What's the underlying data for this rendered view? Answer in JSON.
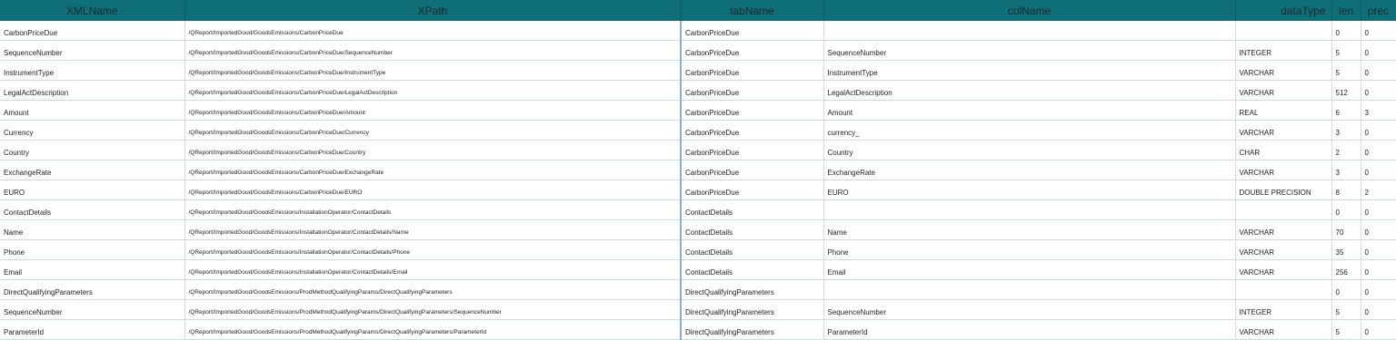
{
  "headers": {
    "xmlname": "XMLName",
    "xpath": "XPath",
    "tabname": "tabName",
    "colname": "colName",
    "datatype": "dataType",
    "len": "len",
    "prec": "prec"
  },
  "rows": [
    {
      "xmlname": "CarbonPriceDue",
      "xpath": "/QReport/ImportedGood/GoodsEmissions/CarbonPriceDue",
      "tabname": "CarbonPriceDue",
      "colname": "",
      "datatype": "",
      "len": "0",
      "prec": "0"
    },
    {
      "xmlname": "SequenceNumber",
      "xpath": "/QReport/ImportedGood/GoodsEmissions/CarbonPriceDue/SequenceNumber",
      "tabname": "CarbonPriceDue",
      "colname": "SequenceNumber",
      "datatype": "INTEGER",
      "len": "5",
      "prec": "0"
    },
    {
      "xmlname": "InstrumentType",
      "xpath": "/QReport/ImportedGood/GoodsEmissions/CarbonPriceDue/InstrumentType",
      "tabname": "CarbonPriceDue",
      "colname": "InstrumentType",
      "datatype": "VARCHAR",
      "len": "5",
      "prec": "0"
    },
    {
      "xmlname": "LegalActDescription",
      "xpath": "/QReport/ImportedGood/GoodsEmissions/CarbonPriceDue/LegalActDescription",
      "tabname": "CarbonPriceDue",
      "colname": "LegalActDescription",
      "datatype": "VARCHAR",
      "len": "512",
      "prec": "0"
    },
    {
      "xmlname": "Amount",
      "xpath": "/QReport/ImportedGood/GoodsEmissions/CarbonPriceDue/Amount",
      "tabname": "CarbonPriceDue",
      "colname": "Amount",
      "datatype": "REAL",
      "len": "6",
      "prec": "3"
    },
    {
      "xmlname": "Currency",
      "xpath": "/QReport/ImportedGood/GoodsEmissions/CarbonPriceDue/Currency",
      "tabname": "CarbonPriceDue",
      "colname": "currency_",
      "datatype": "VARCHAR",
      "len": "3",
      "prec": "0"
    },
    {
      "xmlname": "Country",
      "xpath": "/QReport/ImportedGood/GoodsEmissions/CarbonPriceDue/Country",
      "tabname": "CarbonPriceDue",
      "colname": "Country",
      "datatype": "CHAR",
      "len": "2",
      "prec": "0"
    },
    {
      "xmlname": "ExchangeRate",
      "xpath": "/QReport/ImportedGood/GoodsEmissions/CarbonPriceDue/ExchangeRate",
      "tabname": "CarbonPriceDue",
      "colname": "ExchangeRate",
      "datatype": "VARCHAR",
      "len": "3",
      "prec": "0"
    },
    {
      "xmlname": "EURO",
      "xpath": "/QReport/ImportedGood/GoodsEmissions/CarbonPriceDue/EURO",
      "tabname": "CarbonPriceDue",
      "colname": "EURO",
      "datatype": "DOUBLE PRECISION",
      "len": "8",
      "prec": "2"
    },
    {
      "xmlname": "ContactDetails",
      "xpath": "/QReport/ImportedGood/GoodsEmissions/InstallationOperator/ContactDetails",
      "tabname": "ContactDetails",
      "colname": "",
      "datatype": "",
      "len": "0",
      "prec": "0"
    },
    {
      "xmlname": "Name",
      "xpath": "/QReport/ImportedGood/GoodsEmissions/InstallationOperator/ContactDetails/Name",
      "tabname": "ContactDetails",
      "colname": "Name",
      "datatype": "VARCHAR",
      "len": "70",
      "prec": "0"
    },
    {
      "xmlname": "Phone",
      "xpath": "/QReport/ImportedGood/GoodsEmissions/InstallationOperator/ContactDetails/Phone",
      "tabname": "ContactDetails",
      "colname": "Phone",
      "datatype": "VARCHAR",
      "len": "35",
      "prec": "0"
    },
    {
      "xmlname": "Email",
      "xpath": "/QReport/ImportedGood/GoodsEmissions/InstallationOperator/ContactDetails/Email",
      "tabname": "ContactDetails",
      "colname": "Email",
      "datatype": "VARCHAR",
      "len": "256",
      "prec": "0"
    },
    {
      "xmlname": "DirectQualifyingParameters",
      "xpath": "/QReport/ImportedGood/GoodsEmissions/ProdMethodQualifyingParams/DirectQualifyingParameters",
      "tabname": "DirectQualifyingParameters",
      "colname": "",
      "datatype": "",
      "len": "0",
      "prec": "0"
    },
    {
      "xmlname": "SequenceNumber",
      "xpath": "/QReport/ImportedGood/GoodsEmissions/ProdMethodQualifyingParams/DirectQualifyingParameters/SequenceNumber",
      "tabname": "DirectQualifyingParameters",
      "colname": "SequenceNumber",
      "datatype": "INTEGER",
      "len": "5",
      "prec": "0"
    },
    {
      "xmlname": "ParameterId",
      "xpath": "/QReport/ImportedGood/GoodsEmissions/ProdMethodQualifyingParams/DirectQualifyingParameters/ParameterId",
      "tabname": "DirectQualifyingParameters",
      "colname": "ParameterId",
      "datatype": "VARCHAR",
      "len": "5",
      "prec": "0"
    }
  ]
}
